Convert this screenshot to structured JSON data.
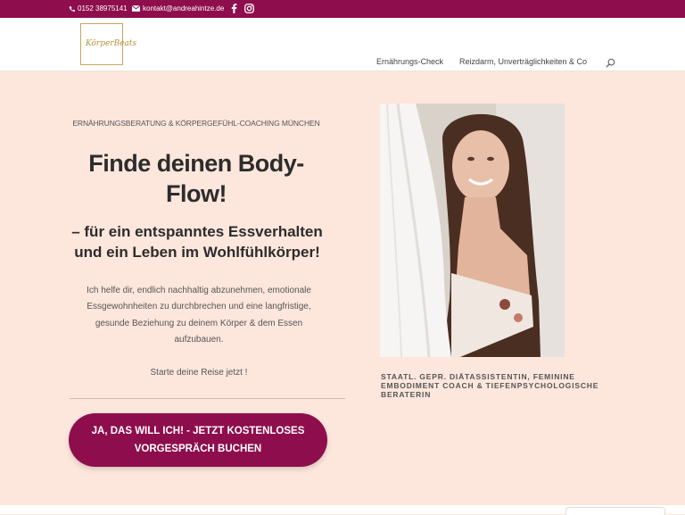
{
  "topbar": {
    "phone": "0152 38975141",
    "email": "kontakt@andreahintze.de",
    "social": [
      "facebook-icon",
      "instagram-icon"
    ]
  },
  "header": {
    "logo_text": "KörperBeats",
    "nav": [
      "Ernährungs-Check",
      "Reizdarm, Unverträglichkeiten & Co"
    ],
    "search_icon": "search-icon"
  },
  "hero": {
    "subheading": "ERNÄHRUNGSBERATUNG & KÖRPERGEFÜHL-COACHING MÜNCHEN",
    "title": "Finde deinen Body-Flow!",
    "tagline": "– für ein entspanntes Essverhalten und ein Leben im Wohlfühlkörper!",
    "description": "Ich helfe dir, endlich nachhaltig abzunehmen, emotionale Essgewohnheiten zu durchbrechen und eine langfristige, gesunde Beziehung zu deinem Körper & dem Essen aufzubauen.",
    "cta_text": "Starte deine Reise jetzt !",
    "cta_button": "JA, DAS WILL ICH! - JETZT KOSTENLOSES VORGESPRÄCH BUCHEN"
  },
  "portrait": {
    "caption": "STAATL. GEPR. DIÄTASSISTENTIN, FEMININE EMBODIMENT COACH & TIEFENPSYCHOLOGISCHE BERATERIN"
  },
  "colors": {
    "brand": "#8e0e4d",
    "background": "#fde6dc",
    "gold": "#c9a55b"
  }
}
